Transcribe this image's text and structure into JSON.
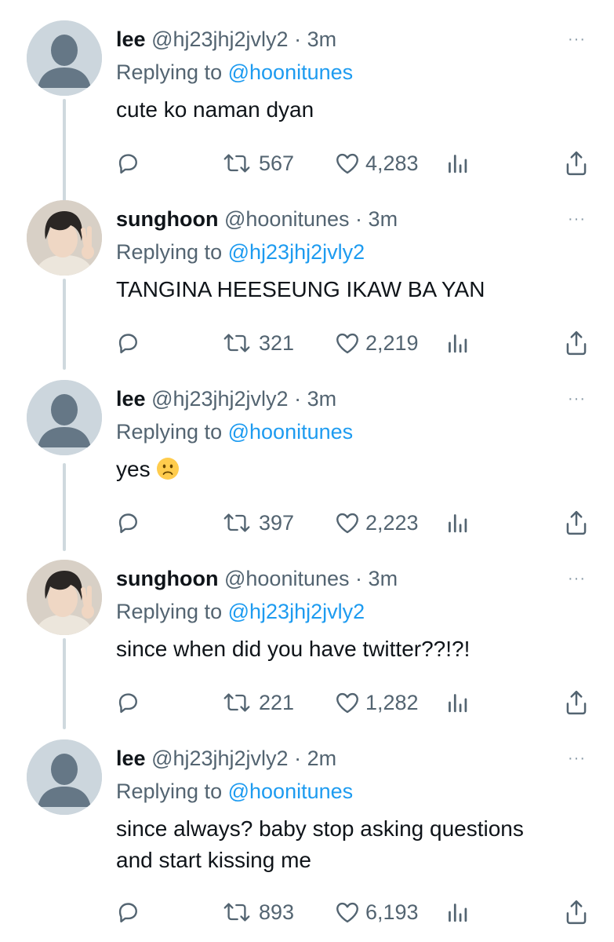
{
  "tweets": [
    {
      "author": "lee",
      "handle": "@hj23jhj2jvly2",
      "time": "3m",
      "reply_prefix": "Replying to",
      "reply_to": "@hoonitunes",
      "text": "cute ko naman dyan",
      "emoji": "",
      "retweets": "567",
      "likes": "4,283",
      "avatar": "default-avatar"
    },
    {
      "author": "sunghoon",
      "handle": "@hoonitunes",
      "time": "3m",
      "reply_prefix": "Replying to",
      "reply_to": "@hj23jhj2jvly2",
      "text": "TANGINA HEESEUNG IKAW BA YAN",
      "emoji": "",
      "retweets": "321",
      "likes": "2,219",
      "avatar": "profile-photo"
    },
    {
      "author": "lee",
      "handle": "@hj23jhj2jvly2",
      "time": "3m",
      "reply_prefix": "Replying to",
      "reply_to": "@hoonitunes",
      "text": "yes",
      "emoji": "frowning-face",
      "retweets": "397",
      "likes": "2,223",
      "avatar": "default-avatar"
    },
    {
      "author": "sunghoon",
      "handle": "@hoonitunes",
      "time": "3m",
      "reply_prefix": "Replying to",
      "reply_to": "@hj23jhj2jvly2",
      "text": "since when did you have twitter??!?!",
      "emoji": "",
      "retweets": "221",
      "likes": "1,282",
      "avatar": "profile-photo"
    },
    {
      "author": "lee",
      "handle": "@hj23jhj2jvly2",
      "time": "2m",
      "reply_prefix": "Replying to",
      "reply_to": "@hoonitunes",
      "text": "since always? baby stop asking questions",
      "text2": "and start kissing me",
      "emoji": "",
      "retweets": "893",
      "likes": "6,193",
      "avatar": "default-avatar"
    }
  ],
  "separator": "·",
  "more_glyph": "···",
  "colors": {
    "text": "#0f1419",
    "secondary": "#536471",
    "accent": "#1d9bf0",
    "thread": "#cfd9de",
    "avatar_bg": "#ccd6dd"
  },
  "icons": [
    "reply-icon",
    "retweet-icon",
    "like-icon",
    "analytics-icon",
    "share-icon",
    "more-icon"
  ]
}
